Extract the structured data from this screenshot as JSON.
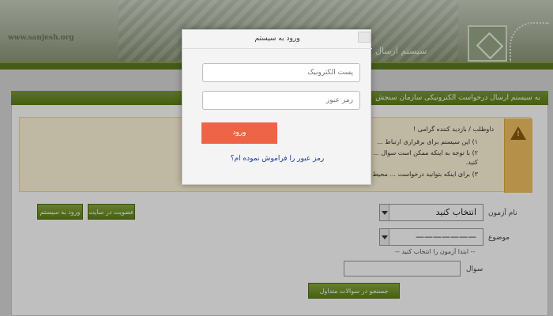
{
  "header": {
    "site_url": "www.sanjesh.org",
    "title": "سیستم ارسال"
  },
  "banner": {
    "text": "به سیستم ارسال درخواست الکترونیکی سازمان سنجش"
  },
  "notice": {
    "greeting": "داوطلب / بازدید کننده گرامی !",
    "lines": [
      "۱) این سیستم برای برقراری ارتباط ...",
      "۲) با توجه به اینکه ممکن است سوال ... سوال جدید، مطالب موجود در بانک سوال را بررسی",
      "کنید.",
      "۳) برای اینکه بتوانید درخواست ... محیط کاربری خود وارد شوید"
    ],
    "side_text": "است"
  },
  "actions": {
    "login_system": "ورود به سیستم",
    "register_site": "عضویت در سایت",
    "search_questions": "جستجو در سوالات متداول"
  },
  "form": {
    "exam_label": "نام آزمون",
    "exam_value": "انتخاب کنید",
    "topic_label": "موضوع",
    "topic_value": "———————",
    "topic_hint": "-- ابتدا آزمون را انتخاب کنید --",
    "question_label": "سوال"
  },
  "modal": {
    "title": "ورود به سیستم",
    "email_placeholder": "پست الکترونیک",
    "password_placeholder": "رمز عبور",
    "login_button": "ورود",
    "forgot_link": "رمز عبور را فراموش نموده ام؟"
  },
  "colors": {
    "accent_green": "#5c7d18",
    "login_button": "#ee6447",
    "link_blue": "#1a39a8",
    "notice_bg": "#fff6d9"
  }
}
